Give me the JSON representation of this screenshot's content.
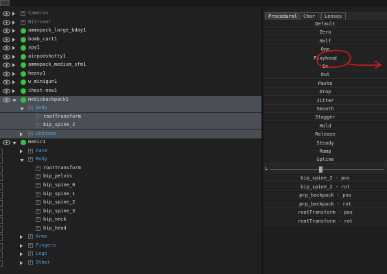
{
  "tree": [
    {
      "label": "Cameras",
      "style": "grey",
      "eye": true,
      "tri": "right",
      "indent": 0,
      "icon": "plus"
    },
    {
      "label": "Nitroser",
      "style": "grey",
      "eye": true,
      "tri": "right",
      "indent": 0,
      "icon": "plus"
    },
    {
      "label": "ammopack_large_bday1",
      "style": "white",
      "eye": true,
      "tri": "right",
      "indent": 0,
      "icon": "dot"
    },
    {
      "label": "bomb_cart1",
      "style": "white",
      "eye": true,
      "tri": "right",
      "indent": 0,
      "icon": "dot"
    },
    {
      "label": "spy1",
      "style": "white",
      "eye": true,
      "tri": "right",
      "indent": 0,
      "icon": "dot"
    },
    {
      "label": "airpodshotty1",
      "style": "white",
      "eye": true,
      "tri": "right",
      "indent": 0,
      "icon": "dot"
    },
    {
      "label": "ammopack_medium_sfm1",
      "style": "white",
      "eye": true,
      "tri": "right",
      "indent": 0,
      "icon": "dot"
    },
    {
      "label": "heavy1",
      "style": "white",
      "eye": true,
      "tri": "right",
      "indent": 0,
      "icon": "dot"
    },
    {
      "label": "w_minigun1",
      "style": "white",
      "eye": true,
      "tri": "right",
      "indent": 0,
      "icon": "dot"
    },
    {
      "label": "chest-new1",
      "style": "white",
      "eye": true,
      "tri": "right",
      "indent": 0,
      "icon": "dot"
    },
    {
      "label": "medicbackpack1",
      "style": "white",
      "eye": true,
      "tri": "down",
      "indent": 0,
      "icon": "dot",
      "sel": "sel"
    },
    {
      "label": "Body",
      "style": "blue",
      "eye": false,
      "tri": "down",
      "indent": 1,
      "icon": "plus",
      "sel": "sel"
    },
    {
      "label": "rootTransform",
      "style": "white",
      "eye": false,
      "tri": "none",
      "indent": 2,
      "icon": "plus",
      "sel": "sel"
    },
    {
      "label": "bip_spine_2",
      "style": "white",
      "eye": false,
      "tri": "none",
      "indent": 2,
      "icon": "plus",
      "sel": "sel"
    },
    {
      "label": "Unknown",
      "style": "blue",
      "eye": false,
      "tri": "right",
      "indent": 1,
      "icon": "plus",
      "sel": "sel"
    },
    {
      "label": "medic1",
      "style": "white",
      "eye": true,
      "tri": "down",
      "indent": 0,
      "icon": "dot"
    },
    {
      "label": "Face",
      "style": "blue",
      "eye": false,
      "tri": "right",
      "indent": 1,
      "icon": "plus"
    },
    {
      "label": "Body",
      "style": "blue",
      "eye": false,
      "tri": "down",
      "indent": 1,
      "icon": "plus"
    },
    {
      "label": "rootTransform",
      "style": "white",
      "eye": false,
      "tri": "none",
      "indent": 2,
      "icon": "plus"
    },
    {
      "label": "bip_pelvis",
      "style": "white",
      "eye": false,
      "tri": "none",
      "indent": 2,
      "icon": "plus"
    },
    {
      "label": "bip_spine_0",
      "style": "white",
      "eye": false,
      "tri": "none",
      "indent": 2,
      "icon": "plus"
    },
    {
      "label": "bip_spine_1",
      "style": "white",
      "eye": false,
      "tri": "none",
      "indent": 2,
      "icon": "plus"
    },
    {
      "label": "bip_spine_2",
      "style": "white",
      "eye": false,
      "tri": "none",
      "indent": 2,
      "icon": "plus"
    },
    {
      "label": "bip_spine_3",
      "style": "white",
      "eye": false,
      "tri": "none",
      "indent": 2,
      "icon": "plus"
    },
    {
      "label": "bip_neck",
      "style": "white",
      "eye": false,
      "tri": "none",
      "indent": 2,
      "icon": "plus"
    },
    {
      "label": "bip_head",
      "style": "white",
      "eye": false,
      "tri": "none",
      "indent": 2,
      "icon": "plus"
    },
    {
      "label": "Arms",
      "style": "blue",
      "eye": false,
      "tri": "right",
      "indent": 1,
      "icon": "plus"
    },
    {
      "label": "Fingers",
      "style": "blue",
      "eye": false,
      "tri": "right",
      "indent": 1,
      "icon": "plus"
    },
    {
      "label": "Legs",
      "style": "blue",
      "eye": false,
      "tri": "right",
      "indent": 1,
      "icon": "plus"
    },
    {
      "label": "Other",
      "style": "blue",
      "eye": false,
      "tri": "right",
      "indent": 1,
      "icon": "plus"
    }
  ],
  "tabs": [
    "Procedural",
    "Char",
    "Lenses"
  ],
  "procedural": [
    "Default",
    "Zero",
    "Half",
    "One",
    "Playhead",
    "In",
    "Out",
    "Paste",
    "Drop",
    "Jitter",
    "Smooth",
    "Stagger",
    "Hold",
    "Release",
    "Steady",
    "Ramp",
    "Spline"
  ],
  "slider": {
    "left_label": "L",
    "value": 0.5
  },
  "controls": [
    "bip_spine_2 - pos",
    "bip_spine_2 - rot",
    "prp_backpack - pos",
    "prp_backpack - rot",
    "rootTransform - pos",
    "rootTransform - rot"
  ],
  "colors": {
    "accent_green": "#3cbf3c",
    "blue_text": "#4da0e6",
    "annotation_red": "#e01818"
  }
}
